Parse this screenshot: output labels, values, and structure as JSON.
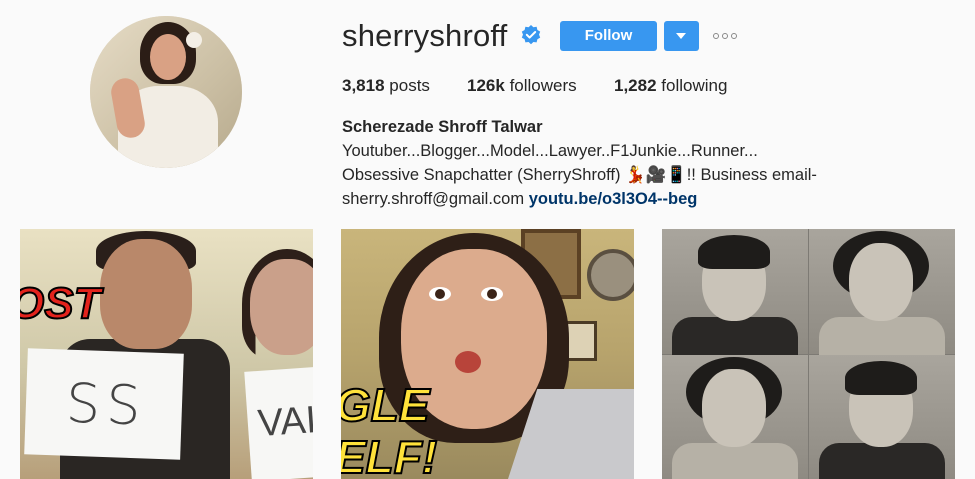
{
  "profile": {
    "username": "sherryshroff",
    "verified": true,
    "follow_label": "Follow",
    "stats": {
      "posts_count": "3,818",
      "posts_label": "posts",
      "followers_count": "126k",
      "followers_label": "followers",
      "following_count": "1,282",
      "following_label": "following"
    },
    "bio": {
      "full_name": "Scherezade Shroff Talwar",
      "text_line1": " Youtuber...Blogger...Model...Lawyer..F1Junkie...Runner...",
      "text_line2": "Obsessive Snapchatter (SherryShroff) 💃🎥📱!! Business email-",
      "text_line3": "sherry.shroff@gmail.com ",
      "link": "youtu.be/o3l3O4--beg"
    }
  },
  "posts": {
    "tile1": {
      "paper1_text": "SS",
      "paper2_text": "VAI",
      "red_text": "OST"
    },
    "tile2": {
      "yellow_text_line1": "GLE",
      "yellow_text_line2": "ELF!"
    }
  },
  "colors": {
    "accent": "#3897f0",
    "link": "#003569",
    "background": "#fafafa"
  },
  "icons": [
    "verified-badge-icon",
    "chevron-down-icon",
    "more-options-icon"
  ]
}
